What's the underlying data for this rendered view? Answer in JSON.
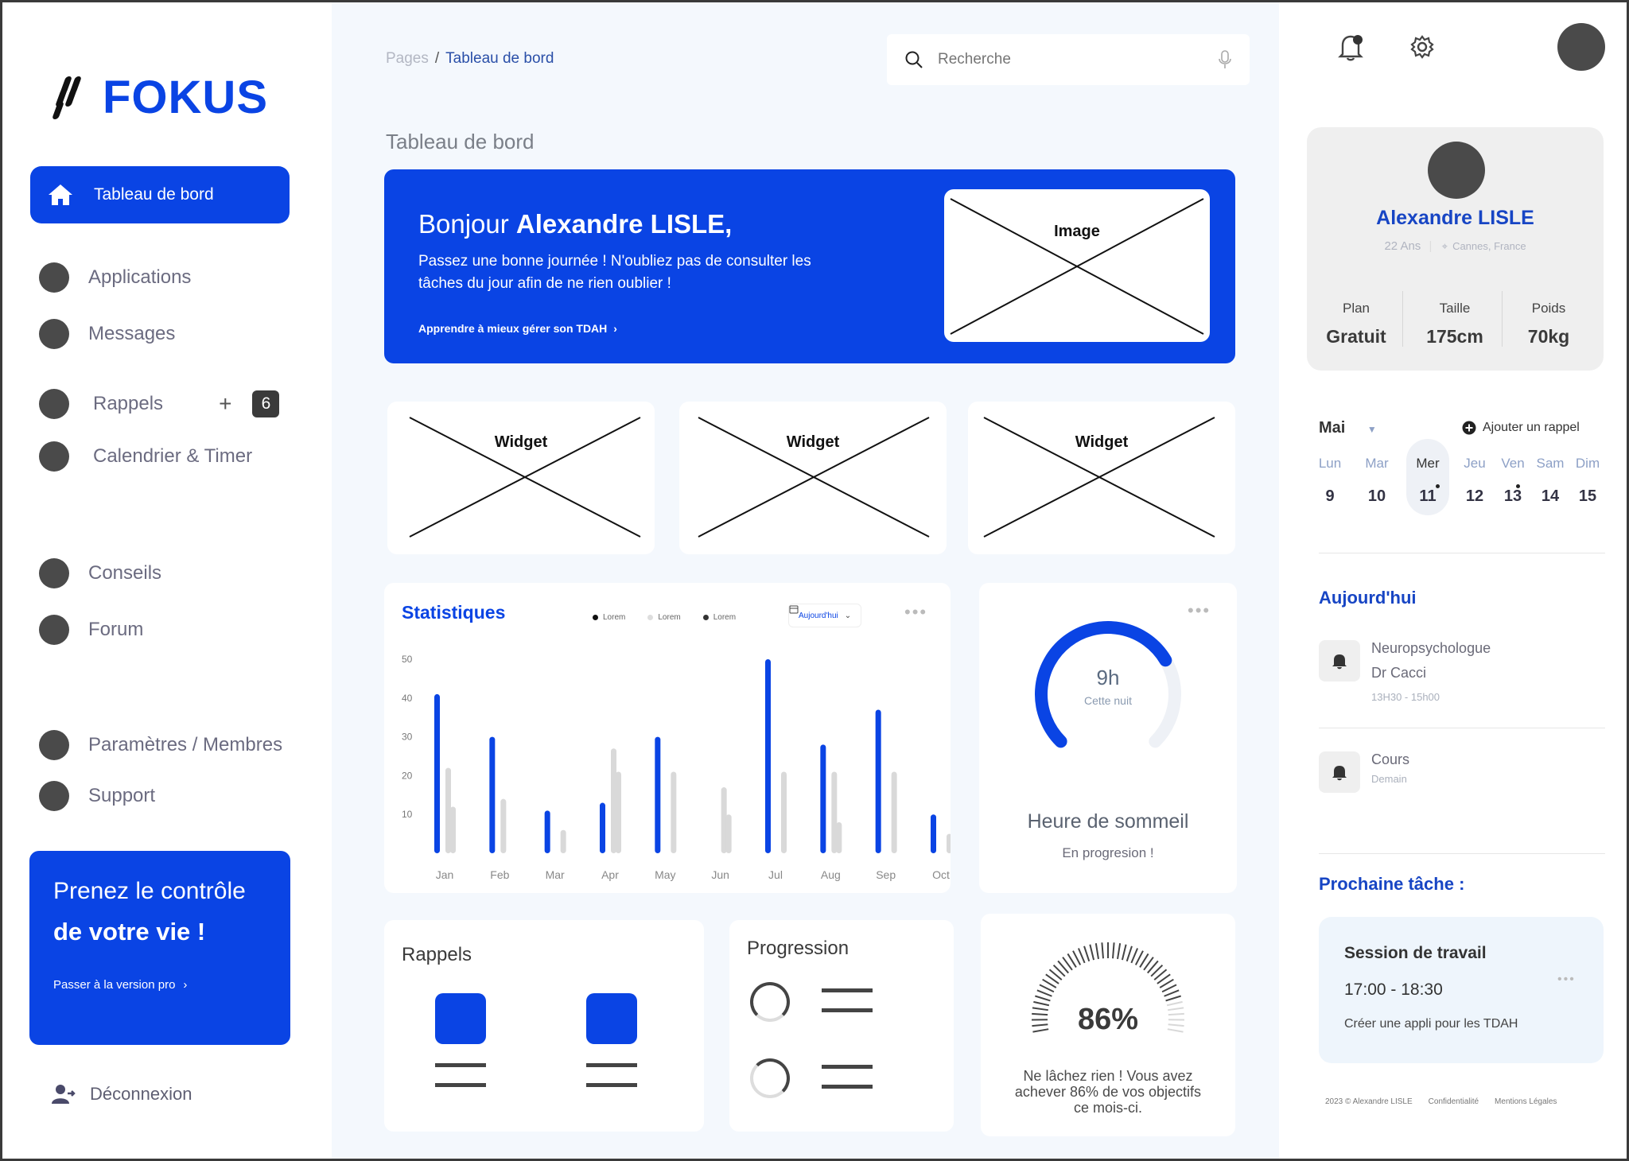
{
  "brand": {
    "name": "FOKUS",
    "accent": "#0a44e4"
  },
  "sidebar": {
    "active": {
      "label": "Tableau de bord",
      "icon": "home-icon"
    },
    "items": [
      {
        "label": "Applications"
      },
      {
        "label": "Messages"
      },
      {
        "label": "Rappels",
        "plus": "+",
        "count": "6"
      },
      {
        "label": "Calendrier & Timer"
      },
      {
        "label": "Conseils"
      },
      {
        "label": "Forum"
      },
      {
        "label": "Paramètres / Membres"
      },
      {
        "label": "Support"
      }
    ],
    "promo": {
      "line1": "Prenez le contrôle",
      "line2": "de votre vie !",
      "link": "Passer à la version pro"
    },
    "logout": "Déconnexion"
  },
  "header": {
    "breadcrumb_root": "Pages",
    "breadcrumb_sep": "/",
    "breadcrumb_current": "Tableau de bord",
    "search_placeholder": "Recherche"
  },
  "page_title": "Tableau de bord",
  "hero": {
    "greet": "Bonjour ",
    "name": "Alexandre LISLE,",
    "text": "Passez une bonne journée ! N'oubliez pas de consulter les tâches du jour afin de ne rien oublier !",
    "link": "Apprendre à mieux  gérer son TDAH",
    "image_label": "Image"
  },
  "widgets": [
    "Widget",
    "Widget",
    "Widget"
  ],
  "stats": {
    "title": "Statistiques",
    "legend": [
      "Lorem",
      "Lorem",
      "Lorem"
    ],
    "period": "Aujourd'hui",
    "chart_data": {
      "type": "bar",
      "categories": [
        "Jan",
        "Feb",
        "Mar",
        "Apr",
        "May",
        "Jun",
        "Jul",
        "Aug",
        "Sep",
        "Oct"
      ],
      "series": [
        {
          "values": [
            41,
            30,
            11,
            13,
            30,
            0,
            50,
            28,
            37,
            10
          ],
          "color": "#0a44e4"
        },
        {
          "values": [
            22,
            14,
            0,
            27,
            0,
            17,
            0,
            21,
            0,
            0
          ],
          "color": "#d9d9d9"
        },
        {
          "values": [
            12,
            0,
            6,
            21,
            21,
            10,
            21,
            8,
            21,
            5
          ],
          "color": "#d9d9d9"
        }
      ],
      "yticks": [
        10,
        20,
        30,
        40,
        50
      ],
      "ylim": [
        0,
        50
      ]
    }
  },
  "sleep": {
    "value": "9h",
    "sub": "Cette nuit",
    "title": "Heure de sommeil",
    "note": "En progresion !",
    "fraction": 0.72
  },
  "rappels": {
    "title": "Rappels"
  },
  "progression": {
    "title": "Progression"
  },
  "goal": {
    "percent": "86%",
    "fraction": 0.86,
    "message": "Ne lâchez rien ! Vous avez achever 86% de vos objectifs ce mois-ci."
  },
  "profile": {
    "name": "Alexandre LISLE",
    "age": "22 Ans",
    "location": "Cannes, France",
    "stats": [
      {
        "label": "Plan",
        "value": "Gratuit"
      },
      {
        "label": "Taille",
        "value": "175cm"
      },
      {
        "label": "Poids",
        "value": "70kg"
      }
    ]
  },
  "calendar": {
    "month": "Mai",
    "add_label": "Ajouter un rappel",
    "days": [
      {
        "name": "Lun",
        "num": "9"
      },
      {
        "name": "Mar",
        "num": "10"
      },
      {
        "name": "Mer",
        "num": "11"
      },
      {
        "name": "Jeu",
        "num": "12"
      },
      {
        "name": "Ven",
        "num": "13"
      },
      {
        "name": "Sam",
        "num": "14"
      },
      {
        "name": "Dim",
        "num": "15"
      }
    ]
  },
  "today": {
    "title": "Aujourd'hui",
    "events": [
      {
        "line1": "Neuropsychologue",
        "line2": "Dr Cacci",
        "time": "13H30 - 15h00"
      },
      {
        "line1": "Cours",
        "line2": "Demain"
      }
    ]
  },
  "next_task": {
    "title": "Prochaine tâche :",
    "name": "Session de travail",
    "time": "17:00 - 18:30",
    "desc": "Créer une appli pour les TDAH"
  },
  "footer": [
    "2023 © Alexandre LISLE",
    "Confidentialité",
    "Mentions Légales"
  ]
}
